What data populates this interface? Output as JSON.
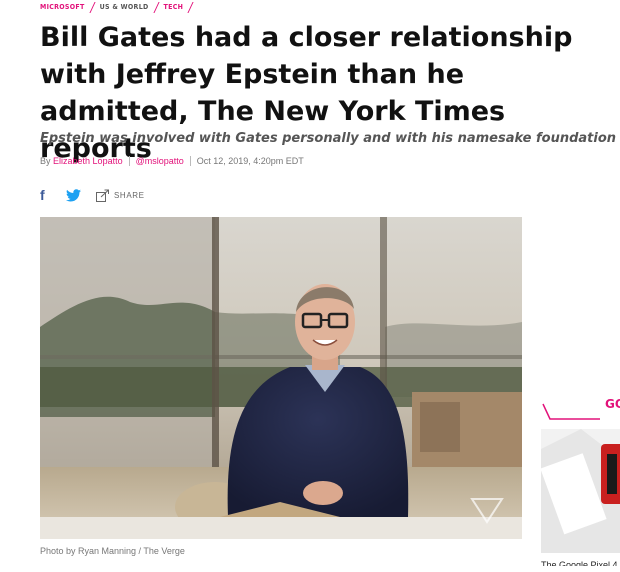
{
  "breadcrumbs": [
    "Microsoft",
    "US & World",
    "Tech"
  ],
  "article": {
    "headline": "Bill Gates had a closer relationship with Jeffrey Epstein than he admitted, The New York Times reports",
    "dek": "Epstein was involved with Gates personally and with his namesake foundation",
    "byline_prefix": "By",
    "author": "Elizabeth Lopatto",
    "author_handle": "@mslopatto",
    "timestamp": "Oct 12, 2019, 4:20pm EDT",
    "share_label": "SHARE",
    "photo_credit": "Photo by Ryan Manning / The Verge"
  },
  "share_icons": [
    "facebook-icon",
    "twitter-icon",
    "share-icon"
  ],
  "sidebar": {
    "heading_fragment": "GO",
    "caption": "The Google Pixel 4"
  },
  "colors": {
    "accent": "#e2127a",
    "text": "#111111",
    "muted": "#777777",
    "facebook": "#3b5998",
    "twitter": "#1da1f2"
  }
}
